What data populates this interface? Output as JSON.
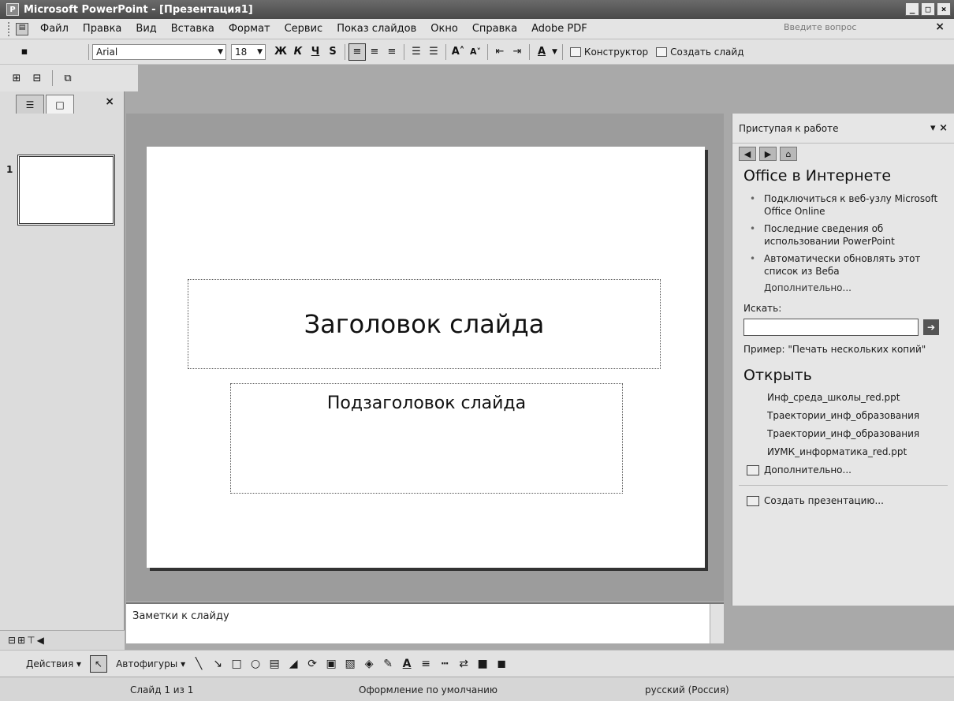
{
  "window": {
    "title": "Microsoft PowerPoint - [Презентация1]",
    "minimize": "_",
    "restore": "□",
    "close": "×"
  },
  "menu": {
    "items": [
      "Файл",
      "Правка",
      "Вид",
      "Вставка",
      "Формат",
      "Сервис",
      "Показ слайдов",
      "Окно",
      "Справка",
      "Adobe PDF"
    ],
    "help_placeholder": "Введите вопрос",
    "close_doc": "×"
  },
  "format_toolbar": {
    "font": "Arial",
    "size": "18",
    "bold": "Ж",
    "italic": "К",
    "underline": "Ч",
    "shadow": "S",
    "design_label": "Конструктор",
    "new_slide_label": "Создать слайд"
  },
  "left_pane": {
    "close": "×",
    "slide_number": "1"
  },
  "slide": {
    "title": "Заголовок слайда",
    "subtitle": "Подзаголовок слайда"
  },
  "notes": {
    "placeholder": "Заметки к слайду"
  },
  "task_pane": {
    "header": "Приступая к работе",
    "office_online_heading": "Office в Интернете",
    "online_items": [
      "Подключиться к веб-узлу Microsoft Office Online",
      "Последние сведения об использовании PowerPoint",
      "Автоматически обновлять этот список из Веба"
    ],
    "more_label": "Дополнительно...",
    "search_label": "Искать:",
    "example": "Пример: \"Печать нескольких копий\"",
    "open_heading": "Открыть",
    "files": [
      "Инф_среда_школы_red.ppt",
      "Траектории_инф_образования",
      "Траектории_инф_образования",
      "ИУМК_информатика_red.ppt"
    ],
    "open_more": "Дополнительно...",
    "create_presentation": "Создать презентацию..."
  },
  "draw_toolbar": {
    "actions": "Действия",
    "autoshapes": "Автофигуры"
  },
  "status": {
    "slide": "Слайд 1 из 1",
    "design": "Оформление по умолчанию",
    "language": "русский (Россия)"
  }
}
